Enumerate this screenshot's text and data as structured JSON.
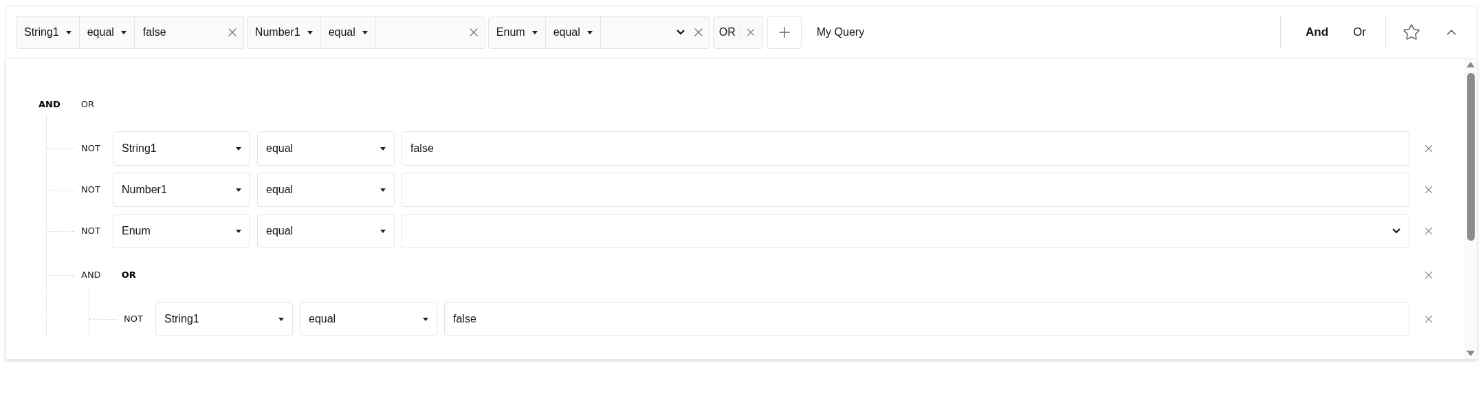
{
  "filter_bar": {
    "chips": [
      {
        "kind": "condition",
        "field": "String1",
        "operator": "equal",
        "value": "false",
        "dropdown": false
      },
      {
        "kind": "condition",
        "field": "Number1",
        "operator": "equal",
        "dropdown": false
      },
      {
        "kind": "condition",
        "field": "Enum",
        "operator": "equal",
        "dropdown": true
      },
      {
        "kind": "connector",
        "label": "OR"
      }
    ],
    "query_name": "My Query",
    "logic": [
      {
        "label": "And",
        "selected": true
      },
      {
        "label": "Or",
        "selected": false
      }
    ]
  },
  "tree": {
    "combinators": [
      {
        "label": "AND",
        "selected": true
      },
      {
        "label": "OR",
        "selected": false
      }
    ],
    "children": [
      {
        "kind": "rule",
        "not": {
          "label": "NOT",
          "selected": false
        },
        "field": "String1",
        "operator": "equal",
        "value": "false",
        "dropdown": false
      },
      {
        "kind": "rule",
        "not": {
          "label": "NOT",
          "selected": false
        },
        "field": "Number1",
        "operator": "equal",
        "dropdown": false
      },
      {
        "kind": "rule",
        "not": {
          "label": "NOT",
          "selected": false
        },
        "field": "Enum",
        "operator": "equal",
        "dropdown": true
      },
      {
        "kind": "group",
        "combinators": [
          {
            "label": "AND",
            "selected": false
          },
          {
            "label": "OR",
            "selected": true
          }
        ],
        "children": [
          {
            "kind": "rule",
            "not": {
              "label": "NOT",
              "selected": false
            },
            "field": "String1",
            "operator": "equal",
            "value": "false",
            "dropdown": false
          }
        ]
      }
    ]
  }
}
